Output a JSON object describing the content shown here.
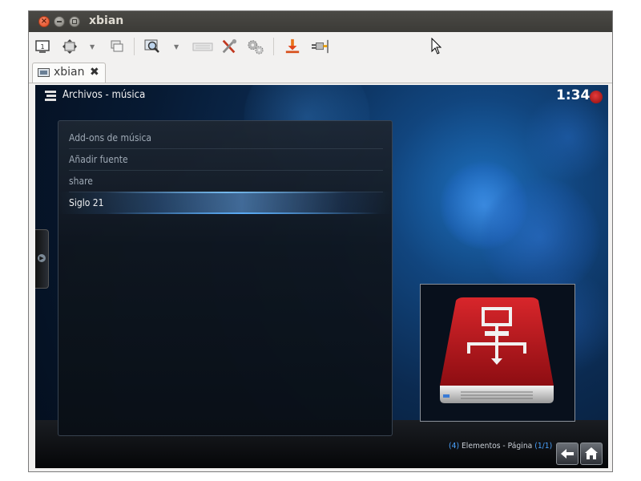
{
  "window": {
    "title": "xbian"
  },
  "toolbar": {
    "icons": [
      "display-icon",
      "move-arrows-icon",
      "windows-icon",
      "zoom-icon",
      "keyboard-icon",
      "tools-icon",
      "gears-icon",
      "download-icon",
      "plug-icon"
    ]
  },
  "tab": {
    "label": "xbian"
  },
  "kodi": {
    "header_title": "Archivos - música",
    "clock": "1:34",
    "items": [
      {
        "label": "Add-ons de música"
      },
      {
        "label": "Añadir fuente"
      },
      {
        "label": "share"
      },
      {
        "label": "Siglo 21"
      }
    ],
    "footer": {
      "count": "4",
      "elements_label": "Elementos - Página",
      "page": "1/1"
    },
    "colors": {
      "accent": "#4aa3ff",
      "power": "#c62020",
      "drive_red": "#b8151b"
    }
  }
}
